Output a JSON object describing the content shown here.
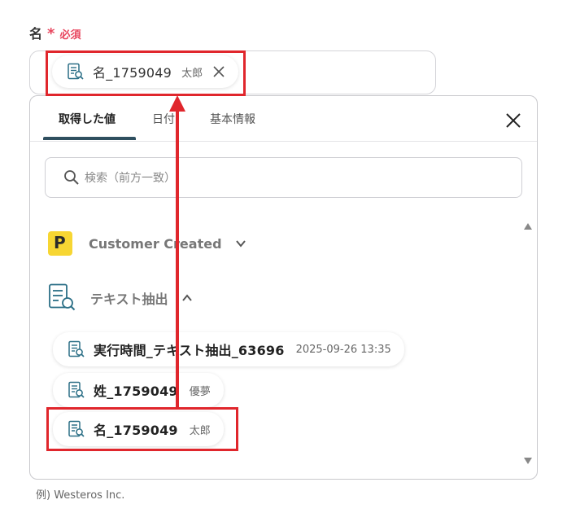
{
  "field": {
    "label": "名",
    "required_star": "*",
    "required_text": "必須",
    "hint": "例) Westeros Inc."
  },
  "selected_chip": {
    "icon": "text-extract-icon",
    "name": "名_1759049",
    "value": "太郎"
  },
  "panel": {
    "tabs": [
      {
        "label": "取得した値",
        "active": true
      },
      {
        "label": "日付",
        "active": false
      },
      {
        "label": "基本情報",
        "active": false
      }
    ],
    "search_placeholder": "検索（前方一致）",
    "groups": [
      {
        "icon": "yellow-p-logo-icon",
        "title": "Customer Created",
        "state": "collapsed"
      },
      {
        "icon": "text-extract-icon",
        "title": "テキスト抽出",
        "state": "expanded"
      }
    ],
    "items": [
      {
        "name": "実行時間_テキスト抽出_63696",
        "value": "2025-09-26 13:35"
      },
      {
        "name": "姓_1759049",
        "value": "優夢"
      },
      {
        "name": "名_1759049",
        "value": "太郎"
      }
    ]
  },
  "annotation": {
    "color": "#e0262c"
  },
  "colors": {
    "required": "#e8475f",
    "tab_underline": "#2f4f5f",
    "logo_yellow": "#f7d633",
    "icon_teal": "#2b6f86"
  }
}
